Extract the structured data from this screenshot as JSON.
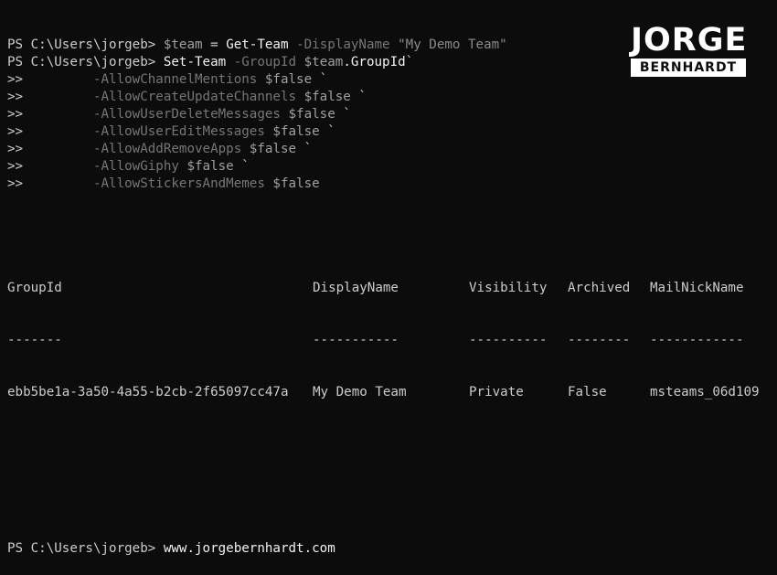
{
  "terminal": {
    "lines": [
      [
        {
          "t": "PS C:\\Users\\jorgeb> ",
          "c": "default"
        },
        {
          "t": "$team",
          "c": "var"
        },
        {
          "t": " = ",
          "c": "default"
        },
        {
          "t": "Get-Team",
          "c": "cmd"
        },
        {
          "t": " -DisplayName ",
          "c": "gray"
        },
        {
          "t": "\"My Demo Team\"",
          "c": "str"
        }
      ],
      [
        {
          "t": "PS C:\\Users\\jorgeb> ",
          "c": "default"
        },
        {
          "t": "Set-Team",
          "c": "cmd"
        },
        {
          "t": " -GroupId ",
          "c": "gray"
        },
        {
          "t": "$team",
          "c": "var"
        },
        {
          "t": ".GroupId",
          "c": "white"
        },
        {
          "t": "`",
          "c": "default"
        }
      ],
      [
        {
          "t": ">>         ",
          "c": "default"
        },
        {
          "t": "-AllowChannelMentions",
          "c": "gray"
        },
        {
          "t": " $false",
          "c": "var"
        },
        {
          "t": " `",
          "c": "default"
        }
      ],
      [
        {
          "t": ">>         ",
          "c": "default"
        },
        {
          "t": "-AllowCreateUpdateChannels",
          "c": "gray"
        },
        {
          "t": " $false",
          "c": "var"
        },
        {
          "t": " `",
          "c": "default"
        }
      ],
      [
        {
          "t": ">>         ",
          "c": "default"
        },
        {
          "t": "-AllowUserDeleteMessages",
          "c": "gray"
        },
        {
          "t": " $false",
          "c": "var"
        },
        {
          "t": " `",
          "c": "default"
        }
      ],
      [
        {
          "t": ">>         ",
          "c": "default"
        },
        {
          "t": "-AllowUserEditMessages",
          "c": "gray"
        },
        {
          "t": " $false",
          "c": "var"
        },
        {
          "t": " `",
          "c": "default"
        }
      ],
      [
        {
          "t": ">>         ",
          "c": "default"
        },
        {
          "t": "-AllowAddRemoveApps",
          "c": "gray"
        },
        {
          "t": " $false",
          "c": "var"
        },
        {
          "t": " `",
          "c": "default"
        }
      ],
      [
        {
          "t": ">>         ",
          "c": "default"
        },
        {
          "t": "-AllowGiphy",
          "c": "gray"
        },
        {
          "t": " $false",
          "c": "var"
        },
        {
          "t": " `",
          "c": "default"
        }
      ],
      [
        {
          "t": ">>         ",
          "c": "default"
        },
        {
          "t": "-AllowStickersAndMemes",
          "c": "gray"
        },
        {
          "t": " $false",
          "c": "var"
        }
      ]
    ],
    "table": {
      "headers": [
        "GroupId",
        "DisplayName",
        "Visibility",
        "Archived",
        "MailNickName"
      ],
      "separators": [
        "-------",
        "-----------",
        "----------",
        "--------",
        "------------"
      ],
      "rows": [
        [
          "ebb5be1a-3a50-4a55-b2cb-2f65097cc47a",
          "My Demo Team",
          "Private",
          "False",
          "msteams_06d109"
        ]
      ]
    },
    "final_prompt": "PS C:\\Users\\jorgeb> ",
    "final_input": "www.jorgebernhardt.com"
  },
  "logo": {
    "top": "JORGE",
    "bottom": "BERNHARDT"
  },
  "colors": {
    "background": "#0c0c0c",
    "default": "#cccccc",
    "gray": "#767676",
    "white": "#f2f2f2"
  }
}
